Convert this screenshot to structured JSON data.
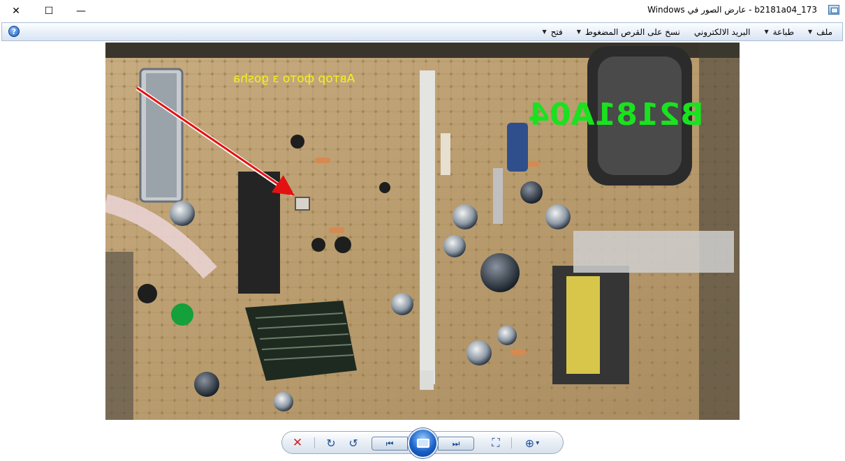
{
  "window": {
    "title": "b2181a04_173 - عارض الصور في Windows",
    "controls": {
      "close": "✕",
      "maximize": "☐",
      "minimize": "—"
    }
  },
  "menu": {
    "items": [
      {
        "label": "ملف",
        "has_dropdown": true
      },
      {
        "label": "طباعة",
        "has_dropdown": true
      },
      {
        "label": "البريد الالكتروني",
        "has_dropdown": false
      },
      {
        "label": "نسخ على القرص المضغوط",
        "has_dropdown": true
      },
      {
        "label": "فتح",
        "has_dropdown": true
      }
    ],
    "help_icon": "?"
  },
  "photo": {
    "overlay_label": "B2181A04",
    "watermark": "Автор фото з gosha",
    "accent_green": "#19e21f",
    "accent_yellow": "#f2f21c",
    "arrow_color": "#e21212"
  },
  "toolbar": {
    "icons": [
      "delete-icon",
      "rotate-clockwise-icon",
      "rotate-counterclockwise-icon",
      "previous-icon",
      "slideshow-icon",
      "next-icon",
      "actual-size-icon",
      "zoom-icon"
    ],
    "glyphs": {
      "delete": "✕",
      "rotate_cw": "↻",
      "rotate_ccw": "↺",
      "previous": "⏮",
      "next": "⏭",
      "actual_size": "⛶",
      "zoom": "⊕",
      "zoom_caret": "▾"
    }
  }
}
